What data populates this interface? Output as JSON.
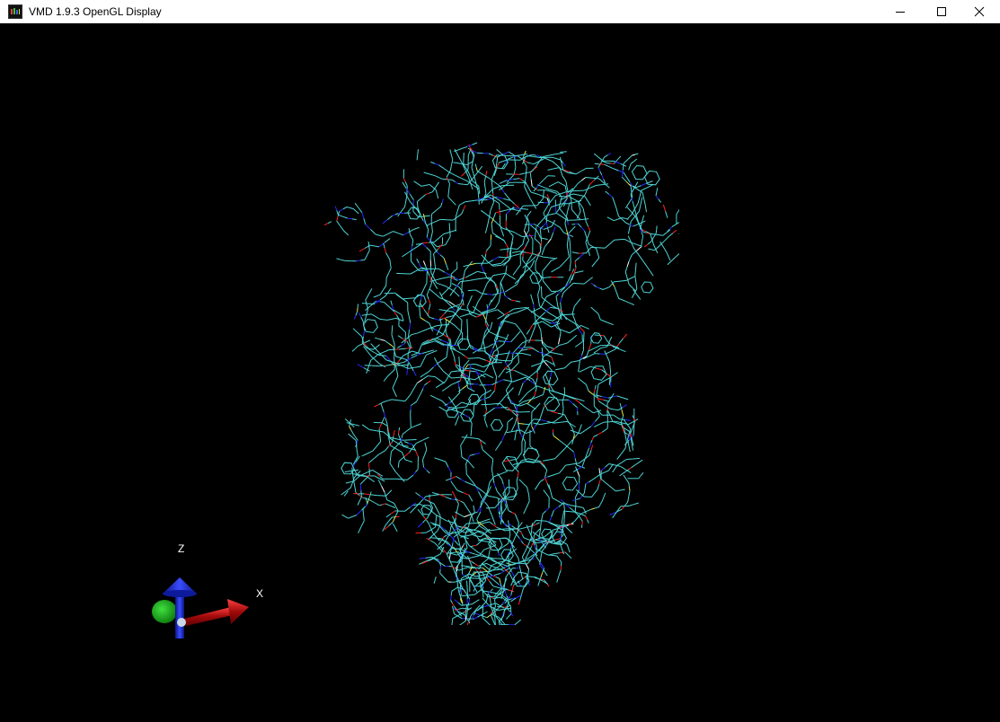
{
  "window": {
    "title": "VMD 1.9.3 OpenGL Display",
    "app_icon": "vmd-logo-icon",
    "controls": [
      "minimize-icon",
      "maximize-icon",
      "close-icon"
    ]
  },
  "display": {
    "background": "#000000",
    "representation": "lines",
    "atom_colors": {
      "carbon": "#4fd6d6",
      "nitrogen": "#2a2aff",
      "oxygen": "#ff2020",
      "sulfur": "#e8e840",
      "hydrogen": "#ffffff"
    }
  },
  "axes": {
    "z_label": "Z",
    "x_label": "X",
    "colors": {
      "x": "#cc1010",
      "y": "#10b010",
      "z": "#1a2ad0"
    }
  }
}
